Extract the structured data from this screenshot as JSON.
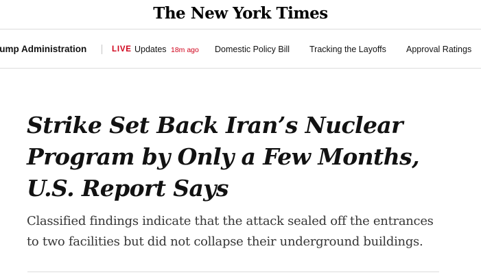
{
  "masthead": {
    "logo_text": "The New York Times"
  },
  "nav": {
    "section_label": "rump Administration",
    "live_label": "LIVE",
    "live_updates_label": "Updates",
    "live_updated_ago": "18m ago",
    "links": [
      "Domestic Policy Bill",
      "Tracking the Layoffs",
      "Approval Ratings"
    ]
  },
  "article": {
    "headline": "Strike Set Back Iran’s Nuclear Program by Only a Few Months, U.S. Report Says",
    "summary": "Classified findings indicate that the attack sealed off the entrances to two facilities but did not collapse their underground buildings."
  },
  "colors": {
    "live_red": "#d0021b",
    "divider": "#dcdcdc",
    "headline_text": "#121212",
    "summary_text": "#363636"
  }
}
